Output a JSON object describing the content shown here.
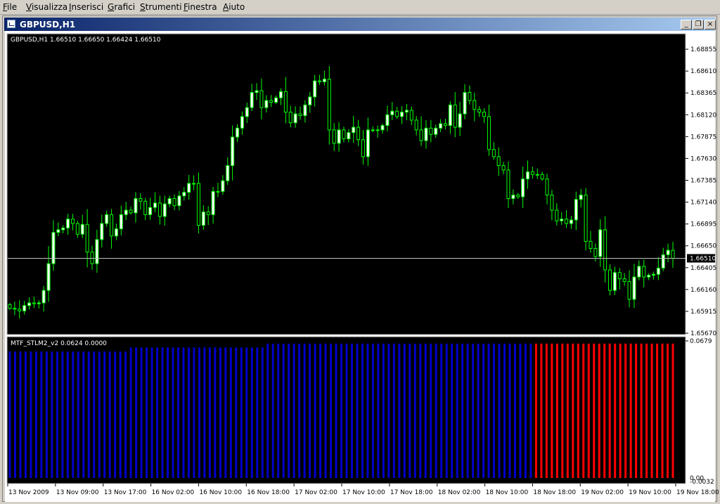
{
  "menu": [
    {
      "label": "File",
      "key": "F"
    },
    {
      "label": "Visualizza",
      "key": "V"
    },
    {
      "label": "Inserisci",
      "key": "I"
    },
    {
      "label": "Grafici",
      "key": "G"
    },
    {
      "label": "Strumenti",
      "key": "S"
    },
    {
      "label": "Finestra",
      "key": "F"
    },
    {
      "label": "Aiuto",
      "key": "A"
    }
  ],
  "window": {
    "title": "GBPUSD,H1",
    "minimize": "_",
    "restore": "❐",
    "close": "×"
  },
  "price_chart": {
    "header": "GBPUSD,H1  1.66510 1.66650 1.66424 1.66510",
    "price_ticks": [
      "1.68855",
      "1.68610",
      "1.68365",
      "1.68120",
      "1.67875",
      "1.67630",
      "1.67385",
      "1.67140",
      "1.66895",
      "1.66650",
      "1.66405",
      "1.66160",
      "1.65915",
      "1.65670"
    ],
    "current_price": "1.66510",
    "colors": {
      "background": "#000000",
      "bull_body": "#ffffff",
      "bear_body": "#000000",
      "candle": "#00ff00",
      "current_line": "#c0c0c0"
    }
  },
  "indicator": {
    "header": "MTF_STLM2_v2 0.0624 0.0000",
    "top_label": "0.0679",
    "bottom_label": "0.00",
    "bottom_label2": "-0.0032",
    "colors": {
      "up": "#0000cc",
      "down": "#ff0000"
    }
  },
  "time_ticks": [
    "13 Nov 2009",
    "13 Nov 09:00",
    "13 Nov 17:00",
    "16 Nov 02:00",
    "16 Nov 10:00",
    "16 Nov 18:00",
    "17 Nov 02:00",
    "17 Nov 10:00",
    "17 Nov 18:00",
    "18 Nov 02:00",
    "18 Nov 10:00",
    "18 Nov 18:00",
    "19 Nov 02:00",
    "19 Nov 10:00",
    "19 Nov 18:00"
  ],
  "chart_data": [
    {
      "type": "candlestick",
      "title": "GBPUSD,H1",
      "ylim": [
        1.6567,
        1.6895
      ],
      "close": [
        1.6595,
        1.6594,
        1.6592,
        1.6598,
        1.6601,
        1.66,
        1.6601,
        1.6615,
        1.6645,
        1.668,
        1.6683,
        1.6685,
        1.6695,
        1.669,
        1.6678,
        1.6689,
        1.6658,
        1.6645,
        1.6672,
        1.669,
        1.67,
        1.6676,
        1.6684,
        1.67,
        1.6705,
        1.6702,
        1.6718,
        1.6715,
        1.67,
        1.6708,
        1.6713,
        1.6698,
        1.6712,
        1.6718,
        1.671,
        1.6721,
        1.6725,
        1.6735,
        1.6735,
        1.6688,
        1.6703,
        1.67,
        1.6726,
        1.6726,
        1.6738,
        1.6755,
        1.6787,
        1.6797,
        1.681,
        1.682,
        1.6837,
        1.6839,
        1.682,
        1.6828,
        1.6826,
        1.6831,
        1.6838,
        1.6815,
        1.6803,
        1.6813,
        1.6811,
        1.6823,
        1.6832,
        1.685,
        1.6849,
        1.6852,
        1.6795,
        1.678,
        1.6795,
        1.6785,
        1.6792,
        1.6798,
        1.6784,
        1.6765,
        1.6795,
        1.6795,
        1.6795,
        1.68,
        1.6812,
        1.6816,
        1.681,
        1.6815,
        1.6817,
        1.6806,
        1.6795,
        1.6783,
        1.6797,
        1.679,
        1.6797,
        1.6802,
        1.68,
        1.6823,
        1.6798,
        1.6813,
        1.6837,
        1.6828,
        1.6818,
        1.6815,
        1.681,
        1.6773,
        1.6765,
        1.6755,
        1.675,
        1.6718,
        1.6722,
        1.672,
        1.674,
        1.6748,
        1.6745,
        1.6745,
        1.674,
        1.6722,
        1.6705,
        1.6693,
        1.6695,
        1.669,
        1.6694,
        1.6717,
        1.6722,
        1.667,
        1.6662,
        1.6653,
        1.6683,
        1.6638,
        1.6615,
        1.6635,
        1.6628,
        1.6625,
        1.6605,
        1.663,
        1.6642,
        1.663,
        1.6632,
        1.6633,
        1.664,
        1.6655,
        1.666,
        1.6651
      ]
    },
    {
      "type": "bar",
      "title": "MTF_STLM2_v2",
      "ylim": [
        -0.0032,
        0.0679
      ],
      "segments": [
        {
          "color": "blue",
          "count": 23,
          "value": 0.0624
        },
        {
          "color": "blue",
          "count": 26,
          "value": 0.0645
        },
        {
          "color": "blue",
          "count": 51,
          "value": 0.0665
        },
        {
          "color": "red",
          "count": 27,
          "value": 0.0665
        }
      ]
    }
  ]
}
